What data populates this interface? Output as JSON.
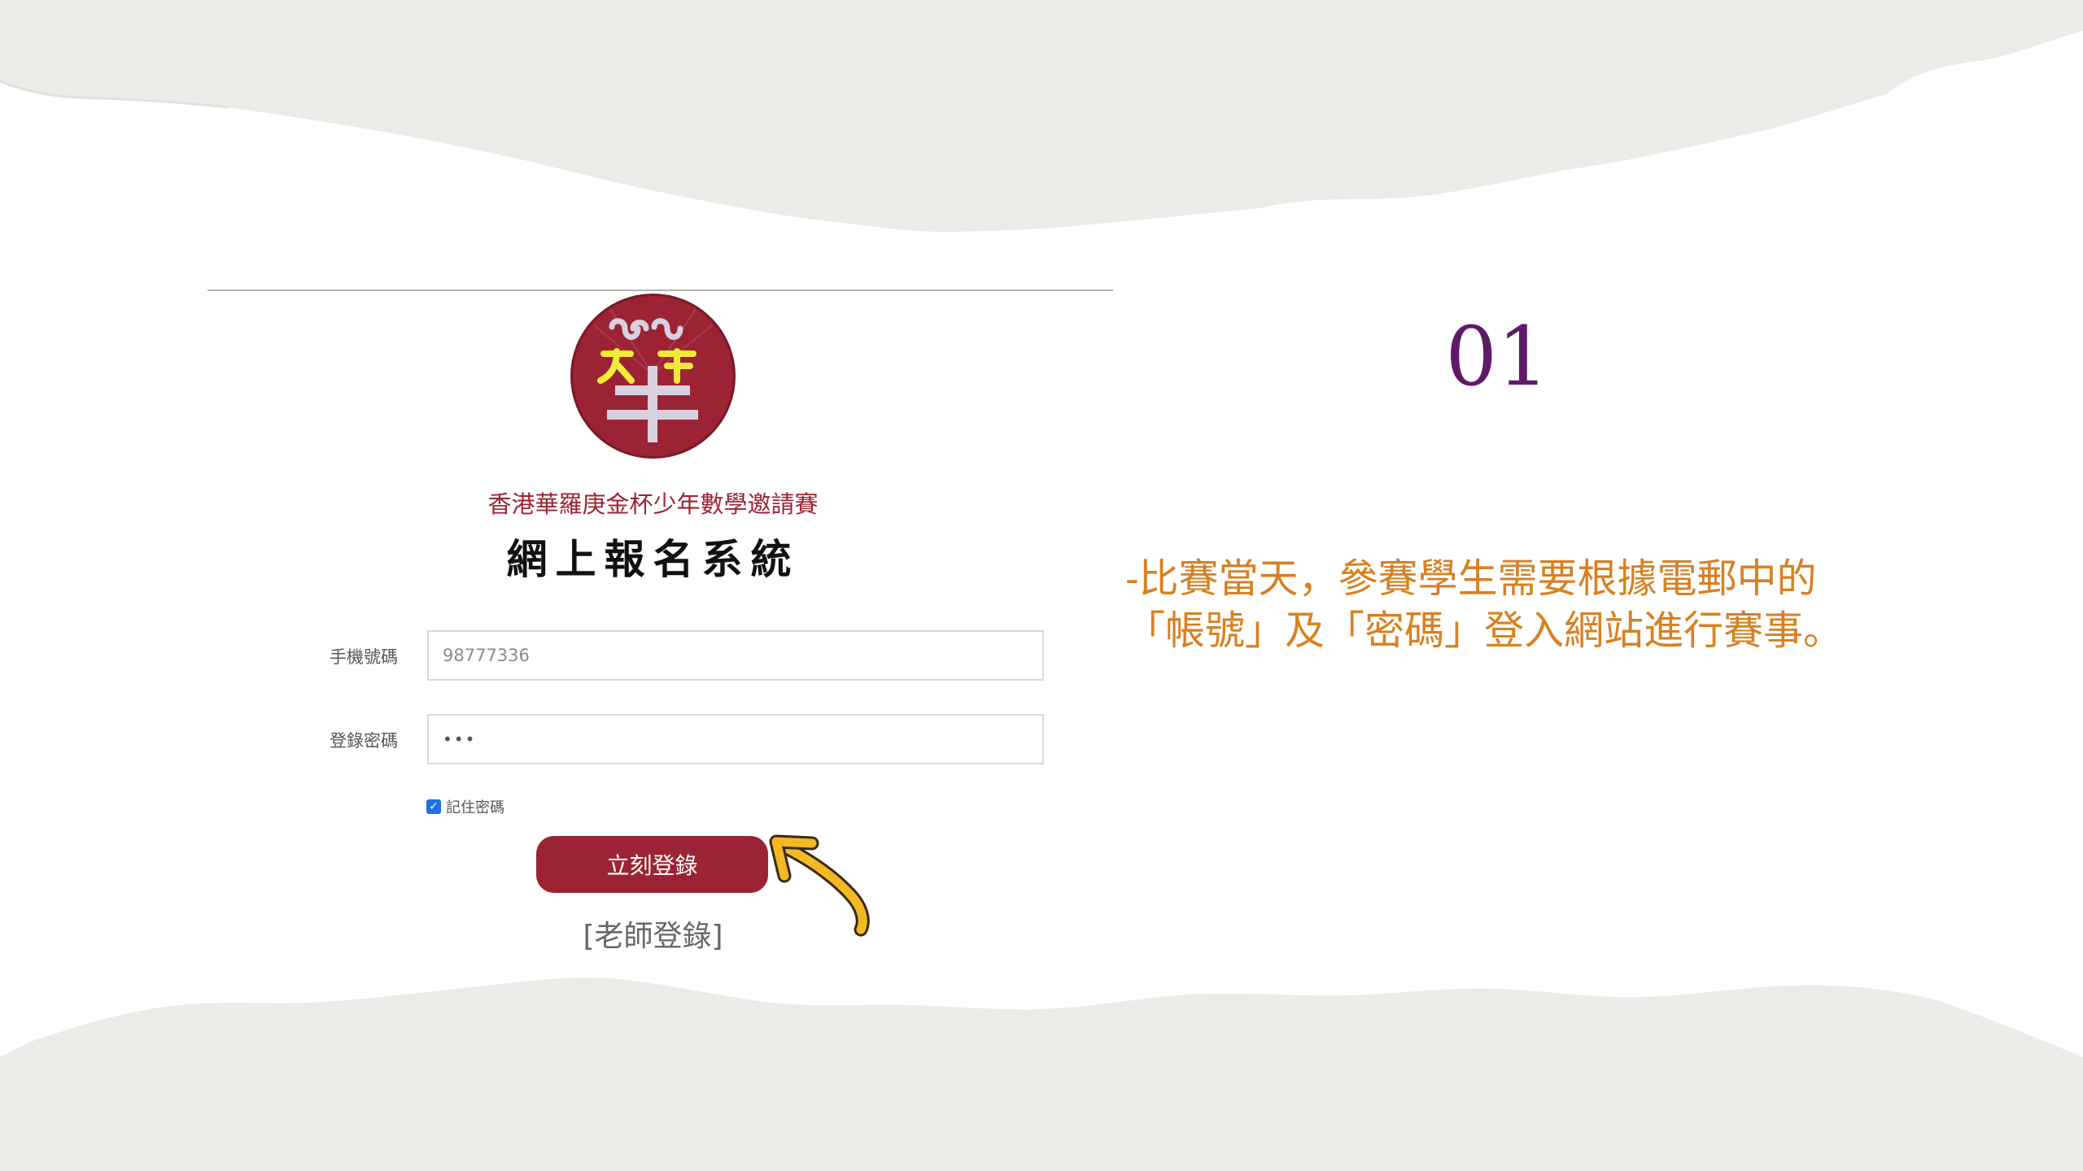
{
  "login_form": {
    "org_name": "香港華羅庚金杯少年數學邀請賽",
    "system_title": "網上報名系統",
    "phone_label": "手機號碼",
    "phone_value": "98777336",
    "password_label": "登錄密碼",
    "password_value": "•••",
    "remember_label": "記住密碼",
    "remember_checked": true,
    "login_button_label": "立刻登錄",
    "teacher_link_label": "[老師登錄]"
  },
  "step_number": "01",
  "instruction_lines": [
    "-比賽當天，參賽學生需要根據電郵中的",
    "「帳號」及「密碼」登入網站進行賽事。"
  ],
  "colors": {
    "brand_red": "#9c2333",
    "step_purple": "#5f1a67",
    "instruction_orange": "#d88020",
    "arrow_yellow": "#f3b925",
    "paper_gray": "#ebebe8"
  },
  "icons": {
    "logo": "hua-logo-emblem",
    "arrow": "pointer-arrow-icon",
    "checkbox": "checkmark-icon"
  }
}
